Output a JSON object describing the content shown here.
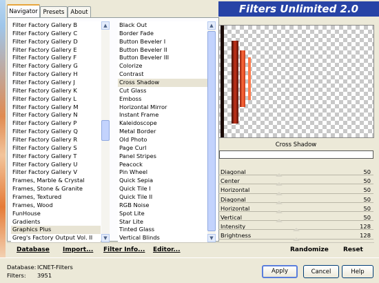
{
  "app": {
    "title": "Filters Unlimited 2.0"
  },
  "tabs": [
    {
      "label": "Navigator"
    },
    {
      "label": "Presets"
    },
    {
      "label": "About"
    }
  ],
  "categories": {
    "items": [
      "Filter Factory Gallery B",
      "Filter Factory Gallery C",
      "Filter Factory Gallery D",
      "Filter Factory Gallery E",
      "Filter Factory Gallery F",
      "Filter Factory Gallery G",
      "Filter Factory Gallery H",
      "Filter Factory Gallery J",
      "Filter Factory Gallery K",
      "Filter Factory Gallery L",
      "Filter Factory Gallery M",
      "Filter Factory Gallery N",
      "Filter Factory Gallery P",
      "Filter Factory Gallery Q",
      "Filter Factory Gallery R",
      "Filter Factory Gallery S",
      "Filter Factory Gallery T",
      "Filter Factory Gallery U",
      "Filter Factory Gallery V",
      "Frames, Marble & Crystal",
      "Frames, Stone & Granite",
      "Frames, Textured",
      "Frames, Wood",
      "FunHouse",
      "Gradients",
      "Graphics Plus",
      "Greg's Factory Output Vol. II"
    ],
    "selected_index": 25
  },
  "filters": {
    "items": [
      "Black Out",
      "Border Fade",
      "Button Beveler I",
      "Button Beveler II",
      "Button Beveler III",
      "Colorize",
      "Contrast",
      "Cross Shadow",
      "Cut Glass",
      "Emboss",
      "Horizontal Mirror",
      "Instant Frame",
      "Kaleidoscope",
      "Metal Border",
      "Old Photo",
      "Page Curl",
      "Panel Stripes",
      "Peacock",
      "Pin Wheel",
      "Quick Sepia",
      "Quick Tile I",
      "Quick Tile II",
      "RGB Noise",
      "Spot Lite",
      "Star Lite",
      "Tinted Glass",
      "Vertical Blinds"
    ],
    "selected_index": 7
  },
  "preview": {
    "filter_name": "Cross Shadow"
  },
  "sliders": [
    {
      "label": "Diagonal",
      "value": "50",
      "fraction": 0.39
    },
    {
      "label": "Center",
      "value": "50",
      "fraction": 0.39
    },
    {
      "label": "Horizontal",
      "value": "50",
      "fraction": 0.39
    },
    {
      "label": "Diagonal",
      "value": "50",
      "fraction": 0.39
    },
    {
      "label": "Horizontal",
      "value": "50",
      "fraction": 0.39
    },
    {
      "label": "Vertical",
      "value": "50",
      "fraction": 0.39
    },
    {
      "label": "Intensity",
      "value": "128",
      "fraction": 0.5
    },
    {
      "label": "Brightness",
      "value": "128",
      "fraction": 0.5
    }
  ],
  "links": {
    "database": "Database",
    "import": "Import...",
    "filter_info": "Filter Info...",
    "editor": "Editor...",
    "randomize": "Randomize",
    "reset": "Reset"
  },
  "footer": {
    "database_label": "Database:",
    "database_value": "ICNET-Filters",
    "filters_label": "Filters:",
    "filters_value": "3951"
  },
  "buttons": {
    "apply": "Apply",
    "cancel": "Cancel",
    "help": "Help"
  }
}
